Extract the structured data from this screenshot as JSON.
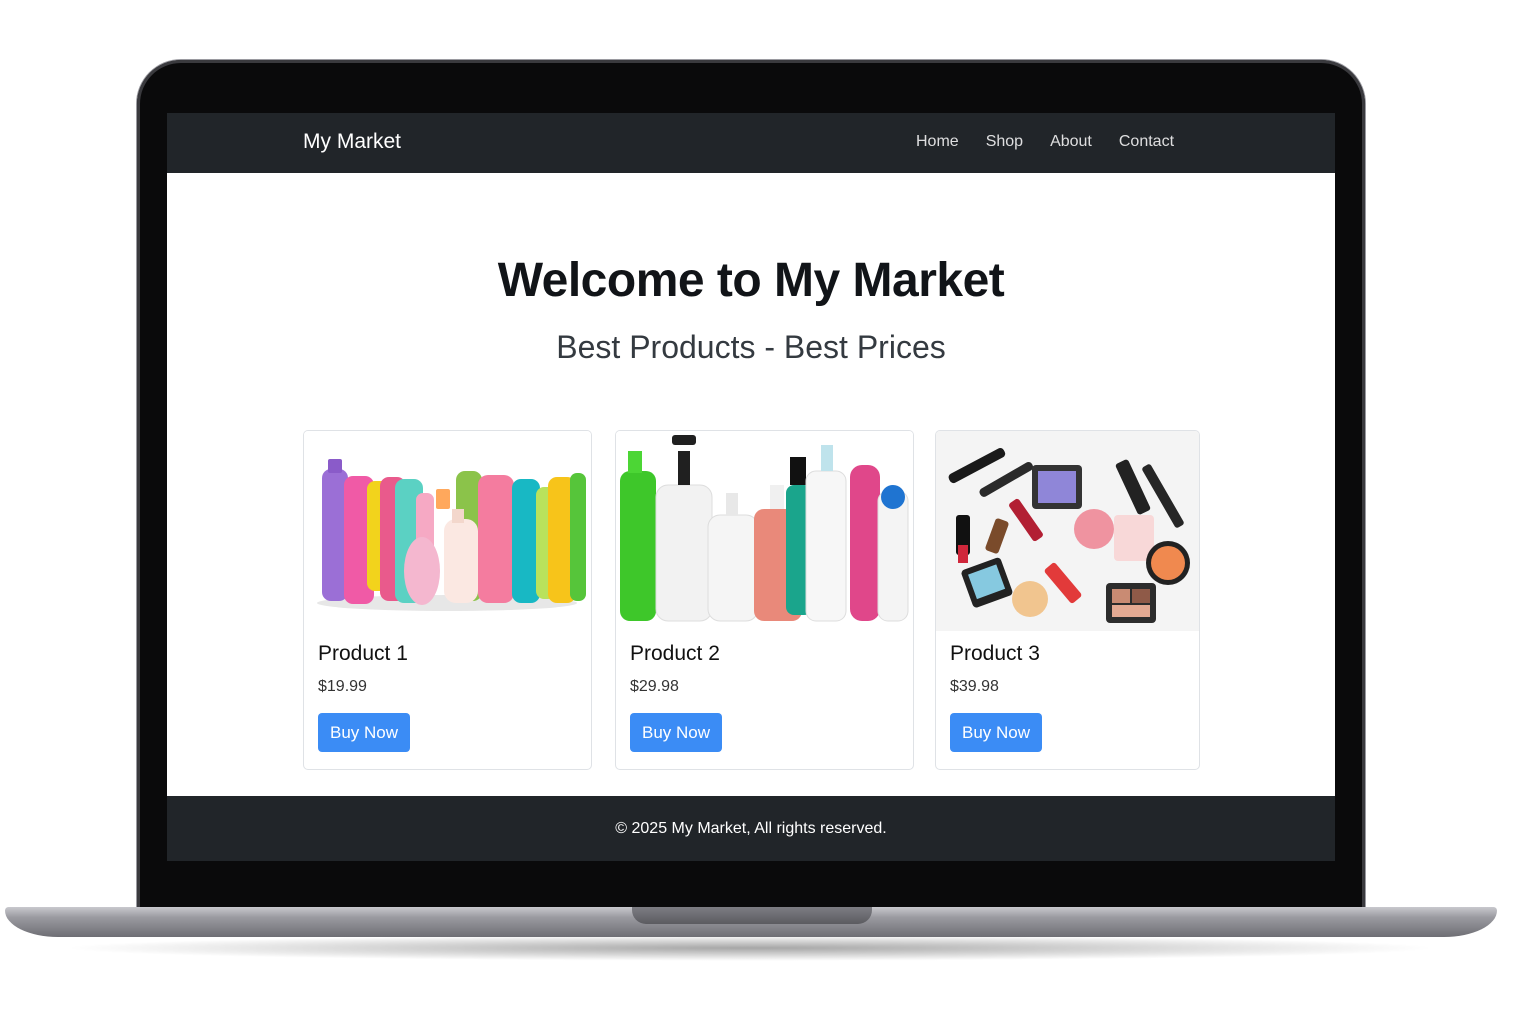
{
  "navbar": {
    "brand": "My Market",
    "links": [
      {
        "label": "Home"
      },
      {
        "label": "Shop"
      },
      {
        "label": "About"
      },
      {
        "label": "Contact"
      }
    ]
  },
  "hero": {
    "title": "Welcome to My Market",
    "subtitle": "Best Products - Best Prices"
  },
  "products": [
    {
      "name": "Product 1",
      "price": "$19.99",
      "button": "Buy Now",
      "image_icon": "shampoo-bottles-image"
    },
    {
      "name": "Product 2",
      "price": "$29.98",
      "button": "Buy Now",
      "image_icon": "pump-bottles-image"
    },
    {
      "name": "Product 3",
      "price": "$39.98",
      "button": "Buy Now",
      "image_icon": "makeup-flatlay-image"
    }
  ],
  "footer": {
    "text": "© 2025 My Market, All rights reserved."
  },
  "colors": {
    "navbar_bg": "#212529",
    "button_bg": "#3b8cf5",
    "laptop_frame": "#0a0a0b",
    "laptop_base": "#9a9aa0"
  }
}
